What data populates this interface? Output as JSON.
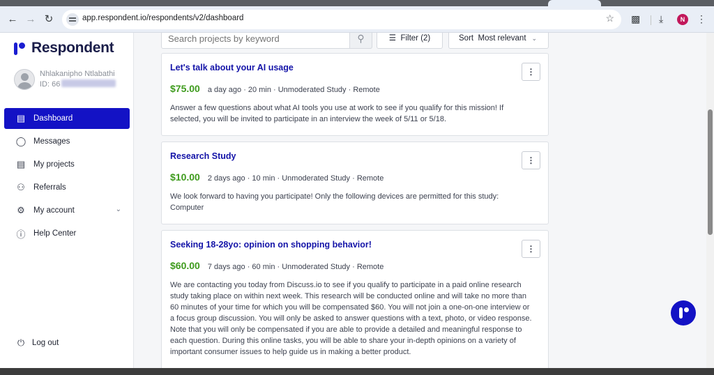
{
  "browser": {
    "url": "app.respondent.io/respondents/v2/dashboard",
    "profile_initial": "N"
  },
  "sidebar": {
    "brand": "Respondent",
    "user_name": "Nhlakanipho Ntlabathi",
    "user_id_prefix": "ID: 66",
    "items": [
      {
        "label": "Dashboard",
        "icon": "dashboard-icon",
        "active": true
      },
      {
        "label": "Messages",
        "icon": "chat-bubble-icon"
      },
      {
        "label": "My projects",
        "icon": "projects-icon"
      },
      {
        "label": "Referrals",
        "icon": "people-icon"
      },
      {
        "label": "My account",
        "icon": "settings-icon"
      },
      {
        "label": "Help Center",
        "icon": "help-icon"
      }
    ],
    "logout_label": "Log out"
  },
  "search": {
    "placeholder": "Search projects by keyword",
    "filter_label": "Filter (2)",
    "sort_prefix": "Sort",
    "sort_value": "Most relevant"
  },
  "projects": [
    {
      "title": "Let's talk about your AI usage",
      "price": "$75.00",
      "meta": "a day ago · 20 min · Unmoderated Study · Remote",
      "description": "Answer a few questions about what AI tools you use at work to see if you qualify for this mission! If selected, you will be invited to participate in an interview the week of 5/11 or 5/18."
    },
    {
      "title": "Research Study",
      "price": "$10.00",
      "meta": "2 days ago · 10 min · Unmoderated Study · Remote",
      "description": "We look forward to having you participate! Only the following devices are permitted for this study: Computer"
    },
    {
      "title": "Seeking 18-28yo: opinion on shopping behavior!",
      "price": "$60.00",
      "meta": "7 days ago · 60 min · Unmoderated Study · Remote",
      "description": "We are contacting you today from Discuss.io to see if you qualify to participate in a paid online research study taking place on within next week. This research will be conducted online and will take no more than 60 minutes of your time for which you will be compensated $60. You will not join a one-on-one interview or a focus group discussion. You will only be asked to answer questions with a text, photo, or video response. Note that you will only be compensated if you are able to provide a detailed and meaningful response to each question. During this online tasks, you will be able to share your in-depth opinions on a variety of important consumer issues to help guide us in making a better product."
    }
  ],
  "colors": {
    "brand": "#1312c5",
    "price": "#3f9b1e",
    "title": "#1414a8"
  }
}
